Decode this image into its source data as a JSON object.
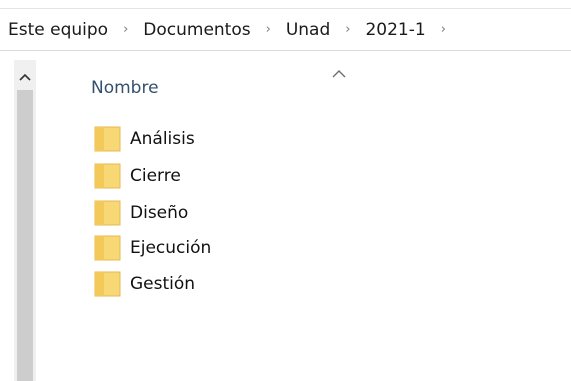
{
  "breadcrumb": {
    "items": [
      {
        "label": "Este equipo"
      },
      {
        "label": "Documentos"
      },
      {
        "label": "Unad"
      },
      {
        "label": "2021-1"
      }
    ],
    "separator": "›"
  },
  "list": {
    "column_header": "Nombre",
    "sort": "ascending",
    "items": [
      {
        "name": "Análisis",
        "icon": "folder-icon"
      },
      {
        "name": "Cierre",
        "icon": "folder-icon"
      },
      {
        "name": "Diseño",
        "icon": "folder-icon"
      },
      {
        "name": "Ejecución",
        "icon": "folder-icon"
      },
      {
        "name": "Gestión",
        "icon": "folder-icon"
      }
    ]
  },
  "colors": {
    "folder": "#f8d775",
    "folder_edge": "#e4b84f",
    "header_text": "#33506e",
    "scrollbar_track": "#f0f0f0",
    "scrollbar_thumb": "#cdcdcd"
  }
}
